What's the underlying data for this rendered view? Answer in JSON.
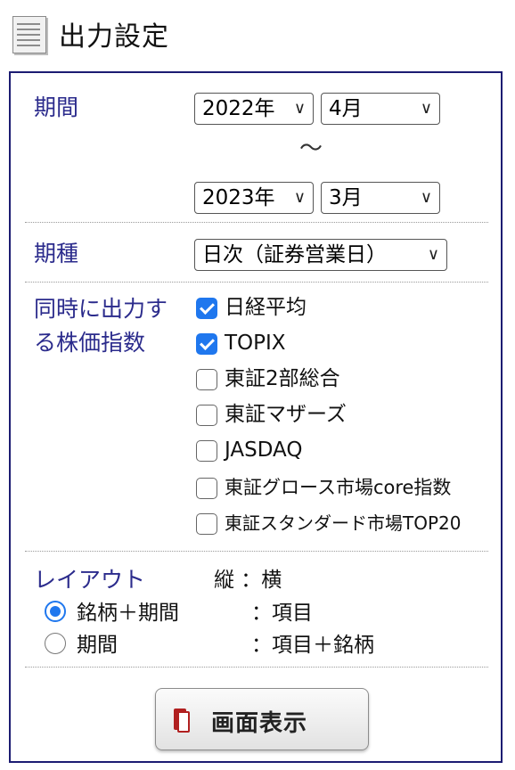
{
  "header": {
    "title": "出力設定"
  },
  "period": {
    "label": "期間",
    "from_year": "2022年",
    "from_month": "4月",
    "separator": "〜",
    "to_year": "2023年",
    "to_month": "3月"
  },
  "period_type": {
    "label": "期種",
    "value": "日次（証券営業日）"
  },
  "indices": {
    "label_line1": "同時に出力す",
    "label_line2": "る株価指数",
    "items": [
      {
        "label": "日経平均",
        "checked": true
      },
      {
        "label": "TOPIX",
        "checked": true
      },
      {
        "label": "東証2部総合",
        "checked": false
      },
      {
        "label": "東証マザーズ",
        "checked": false
      },
      {
        "label": "JASDAQ",
        "checked": false
      },
      {
        "label": "東証グロース市場core指数",
        "checked": false
      },
      {
        "label": "東証スタンダード市場TOP20",
        "checked": false
      }
    ]
  },
  "layout": {
    "label": "レイアウト",
    "header_axes": "縦 ：横",
    "options": [
      {
        "label": "銘柄＋期間",
        "value": "：項目",
        "selected": true
      },
      {
        "label": "期間",
        "value": "：項目＋銘柄",
        "selected": false
      }
    ]
  },
  "submit": {
    "label": "画面表示"
  },
  "colors": {
    "label_text": "#2b2b8c",
    "panel_border": "#1c1c72",
    "accent": "#1f77ee",
    "button_icon": "#b12020"
  }
}
